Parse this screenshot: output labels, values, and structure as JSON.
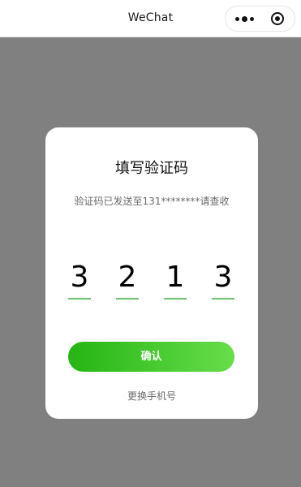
{
  "topbar": {
    "title": "WeChat",
    "more_icon": "more-dots-icon",
    "close_icon": "target-circle-icon"
  },
  "card": {
    "title": "填写验证码",
    "subtitle": "验证码已发送至131********请查收",
    "digits": [
      "3",
      "2",
      "1",
      "3"
    ],
    "confirm_label": "确认",
    "change_phone_label": "更换手机号"
  },
  "colors": {
    "overlay": "#808080",
    "accent_start": "#25b514",
    "accent_end": "#67dd4a",
    "underline": "#6dbe6d"
  }
}
